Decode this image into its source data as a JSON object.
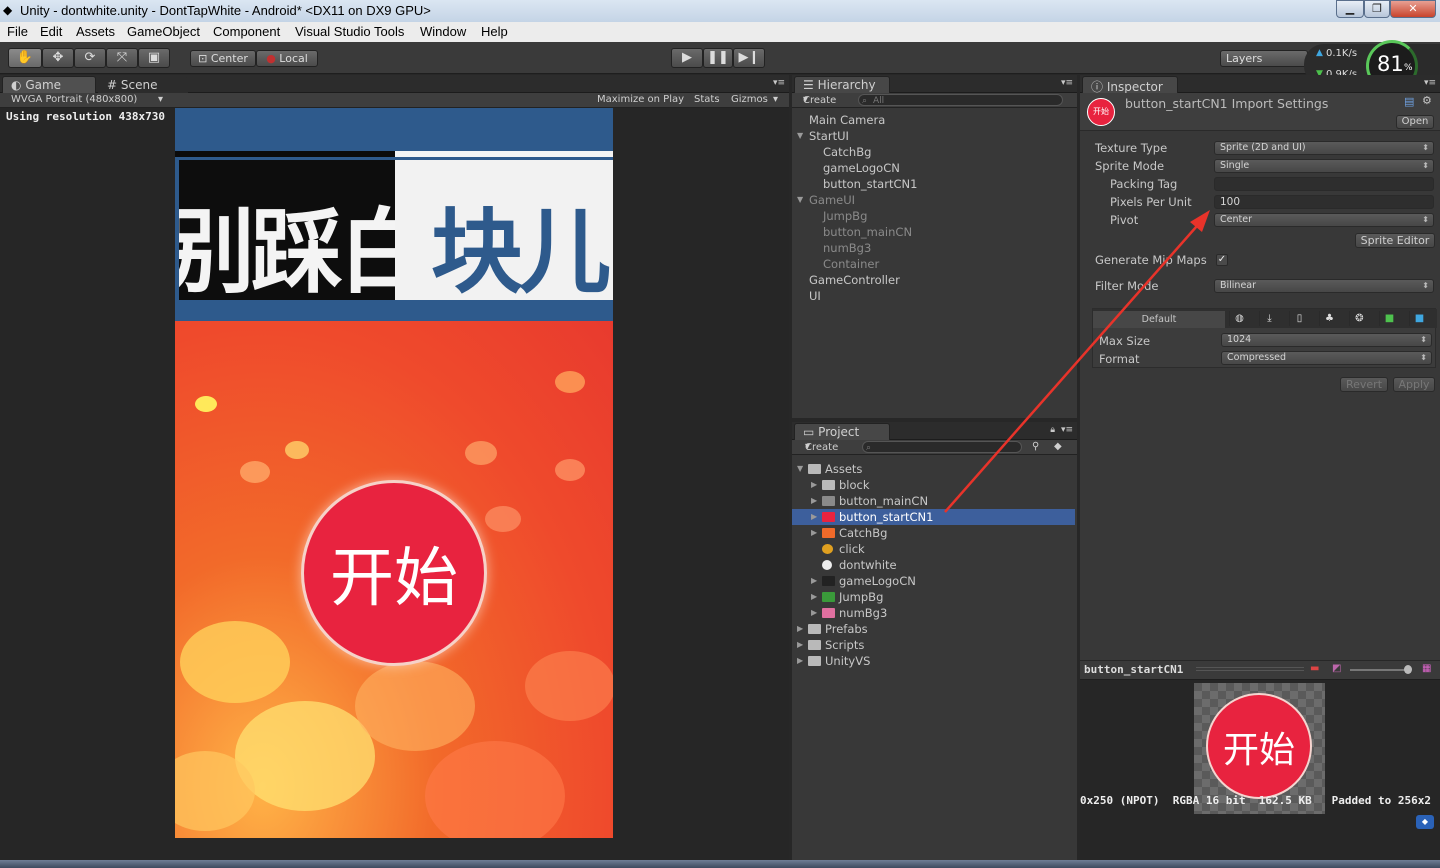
{
  "window": {
    "title": "Unity - dontwhite.unity - DontTapWhite - Android* <DX11 on DX9 GPU>"
  },
  "menu": [
    "File",
    "Edit",
    "Assets",
    "GameObject",
    "Component",
    "Visual Studio Tools",
    "Window",
    "Help"
  ],
  "toolbar": {
    "center_label": "Center",
    "local_label": "Local",
    "layers_label": "Layers",
    "net_up": "0.1K/s",
    "net_down": "0.9K/s",
    "cpu_percent": "81",
    "cpu_unit": "%"
  },
  "game": {
    "tab_game": "Game",
    "tab_scene": "Scene",
    "resolution_dropdown": "WVGA Portrait (480x800)",
    "maximize": "Maximize on Play",
    "stats": "Stats",
    "gizmos": "Gizmos",
    "resolution_text": "Using resolution 438x730",
    "logo_dark_text": "别踩白",
    "logo_light_text": "块儿",
    "start_button": "开始"
  },
  "hierarchy": {
    "tab": "Hierarchy",
    "create": "Create",
    "search_placeholder": "All",
    "items": [
      {
        "label": "Main Camera",
        "indent": 0,
        "dim": false
      },
      {
        "label": "StartUI",
        "indent": 0,
        "dim": false,
        "expanded": true
      },
      {
        "label": "CatchBg",
        "indent": 1,
        "dim": false
      },
      {
        "label": "gameLogoCN",
        "indent": 1,
        "dim": false
      },
      {
        "label": "button_startCN1",
        "indent": 1,
        "dim": false
      },
      {
        "label": "GameUI",
        "indent": 0,
        "dim": true,
        "expanded": true
      },
      {
        "label": "JumpBg",
        "indent": 1,
        "dim": true
      },
      {
        "label": "button_mainCN",
        "indent": 1,
        "dim": true
      },
      {
        "label": "numBg3",
        "indent": 1,
        "dim": true
      },
      {
        "label": "Container",
        "indent": 1,
        "dim": true
      },
      {
        "label": "GameController",
        "indent": 0,
        "dim": false
      },
      {
        "label": "UI",
        "indent": 0,
        "dim": false
      }
    ]
  },
  "project": {
    "tab": "Project",
    "create": "Create",
    "items": [
      {
        "label": "Assets",
        "indent": 0,
        "icon": "folder-icon",
        "expander": true,
        "selected": false
      },
      {
        "label": "block",
        "indent": 1,
        "icon": "folder-icon",
        "expander": true,
        "selected": false
      },
      {
        "label": "button_mainCN",
        "indent": 1,
        "icon": "sprite-icon",
        "expander": true,
        "selected": false
      },
      {
        "label": "button_startCN1",
        "indent": 1,
        "icon": "sprite-red-icon",
        "expander": true,
        "selected": true
      },
      {
        "label": "CatchBg",
        "indent": 1,
        "icon": "sprite-orange-icon",
        "expander": true,
        "selected": false
      },
      {
        "label": "click",
        "indent": 1,
        "icon": "audio-icon",
        "expander": false,
        "selected": false
      },
      {
        "label": "dontwhite",
        "indent": 1,
        "icon": "unity-scene-icon",
        "expander": false,
        "selected": false
      },
      {
        "label": "gameLogoCN",
        "indent": 1,
        "icon": "sprite-dark-icon",
        "expander": true,
        "selected": false
      },
      {
        "label": "JumpBg",
        "indent": 1,
        "icon": "sprite-green-icon",
        "expander": true,
        "selected": false
      },
      {
        "label": "numBg3",
        "indent": 1,
        "icon": "sprite-pink-icon",
        "expander": true,
        "selected": false
      },
      {
        "label": "Prefabs",
        "indent": 0,
        "icon": "folder-icon",
        "expander": true,
        "selected": false
      },
      {
        "label": "Scripts",
        "indent": 0,
        "icon": "folder-icon",
        "expander": true,
        "selected": false
      },
      {
        "label": "UnityVS",
        "indent": 0,
        "icon": "folder-icon",
        "expander": true,
        "selected": false
      }
    ]
  },
  "inspector": {
    "tab": "Inspector",
    "asset_title": "button_startCN1 Import Settings",
    "open_button": "Open",
    "texture_type_label": "Texture Type",
    "texture_type_value": "Sprite (2D and UI)",
    "sprite_mode_label": "Sprite Mode",
    "sprite_mode_value": "Single",
    "packing_tag_label": "Packing Tag",
    "packing_tag_value": "",
    "ppu_label": "Pixels Per Unit",
    "ppu_value": "100",
    "pivot_label": "Pivot",
    "pivot_value": "Center",
    "sprite_editor_button": "Sprite Editor",
    "mipmaps_label": "Generate Mip Maps",
    "mipmaps_checked": true,
    "filter_label": "Filter Mode",
    "filter_value": "Bilinear",
    "platform_default": "Default",
    "max_size_label": "Max Size",
    "max_size_value": "1024",
    "format_label": "Format",
    "format_value": "Compressed",
    "revert_button": "Revert",
    "apply_button": "Apply",
    "preview_name": "button_startCN1",
    "preview_info": "0x250 (NPOT)  RGBA 16 bit  162.5 KB   Padded to 256x2",
    "preview_button_text": "开始",
    "thumb_text": "开始"
  },
  "colors": {
    "selection": "#3d5f9c",
    "start_button_red": "#e8233f",
    "logo_band": "#2f5d8e",
    "annotation_arrow": "#e8332a"
  }
}
